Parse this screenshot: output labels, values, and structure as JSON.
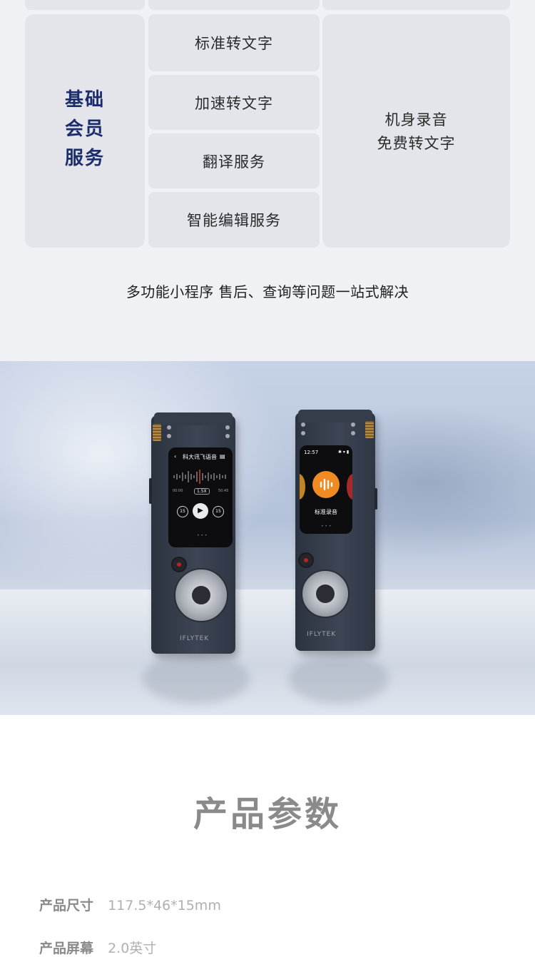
{
  "membership": {
    "basic_title_lines": [
      "基础",
      "会员",
      "服务"
    ],
    "services": [
      "标准转文字",
      "加速转文字",
      "翻译服务",
      "智能编辑服务"
    ],
    "free_lines": [
      "机身录音",
      "免费转文字"
    ],
    "tagline": "多功能小程序 售后、查询等问题一站式解决",
    "title_color": "#1c2d6b"
  },
  "product_photo": {
    "left_device": {
      "screen_title": "科大讯飞语音",
      "time_start": "00:00",
      "speed": "1.5X",
      "time_end": "50:45",
      "skip_back": "15",
      "skip_fwd": "15",
      "brand": "IFLYTEK"
    },
    "right_device": {
      "clock": "12:57",
      "mode_label": "标准录音",
      "brand": "IFLYTEK"
    }
  },
  "params": {
    "title": "产品参数",
    "rows": [
      {
        "label": "产品尺寸",
        "value": "117.5*46*15mm"
      },
      {
        "label": "产品屏幕",
        "value": "2.0英寸"
      }
    ]
  }
}
